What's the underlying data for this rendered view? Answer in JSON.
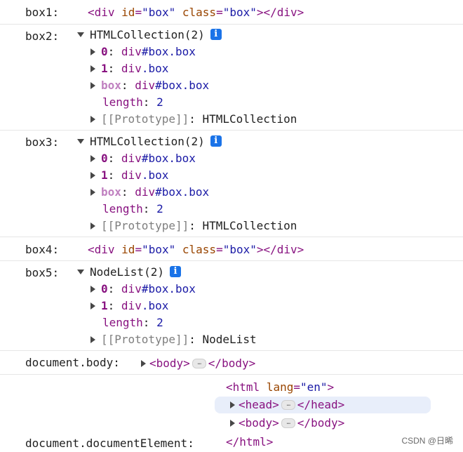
{
  "rows": {
    "box1": {
      "label": "box1:",
      "open": "<div",
      "attr1": "id",
      "eq1": "=",
      "val1": "\"box\"",
      "attr2": "class",
      "eq2": "=",
      "val2": "\"box\"",
      "close": "></div>"
    },
    "box2": {
      "label": "box2:",
      "header": "HTMLCollection(2)",
      "items": [
        {
          "key": "0",
          "sep": ":",
          "name": "div",
          "rest": "#box.box"
        },
        {
          "key": "1",
          "sep": ":",
          "name": "div",
          "rest": ".box"
        },
        {
          "key": "box",
          "sep": ":",
          "name": "div",
          "rest": "#box.box"
        }
      ],
      "length_key": "length",
      "length_sep": ":",
      "length_val": "2",
      "proto_key": "[[Prototype]]",
      "proto_sep": ":",
      "proto_val": "HTMLCollection"
    },
    "box3": {
      "label": "box3:",
      "header": "HTMLCollection(2)",
      "items": [
        {
          "key": "0",
          "sep": ":",
          "name": "div",
          "rest": "#box.box"
        },
        {
          "key": "1",
          "sep": ":",
          "name": "div",
          "rest": ".box"
        },
        {
          "key": "box",
          "sep": ":",
          "name": "div",
          "rest": "#box.box"
        }
      ],
      "length_key": "length",
      "length_sep": ":",
      "length_val": "2",
      "proto_key": "[[Prototype]]",
      "proto_sep": ":",
      "proto_val": "HTMLCollection"
    },
    "box4": {
      "label": "box4:",
      "open": "<div",
      "attr1": "id",
      "eq1": "=",
      "val1": "\"box\"",
      "attr2": "class",
      "eq2": "=",
      "val2": "\"box\"",
      "close": "></div>"
    },
    "box5": {
      "label": "box5:",
      "header": "NodeList(2)",
      "items": [
        {
          "key": "0",
          "sep": ":",
          "name": "div",
          "rest": "#box.box"
        },
        {
          "key": "1",
          "sep": ":",
          "name": "div",
          "rest": ".box"
        }
      ],
      "length_key": "length",
      "length_sep": ":",
      "length_val": "2",
      "proto_key": "[[Prototype]]",
      "proto_sep": ":",
      "proto_val": "NodeList"
    },
    "body": {
      "label": "document.body:",
      "open": "<body>",
      "ellipsis": "…",
      "close": "</body>"
    },
    "docEl": {
      "label": "document.documentElement:",
      "html_open": "<html",
      "html_attr": "lang",
      "html_eq": "=",
      "html_val": "\"en\"",
      "html_gt": ">",
      "head_open": "<head>",
      "head_close": "</head>",
      "body_open": "<body>",
      "body_close": "</body>",
      "ellipsis": "…",
      "html_close": "</html>"
    }
  },
  "info_glyph": "i",
  "watermark": "CSDN @日晞",
  "colors": {
    "tag": "#881280",
    "attr_name": "#994500",
    "attr_value": "#1a1aa6",
    "info_badge": "#1a73e8",
    "highlight": "#e8eefa"
  }
}
